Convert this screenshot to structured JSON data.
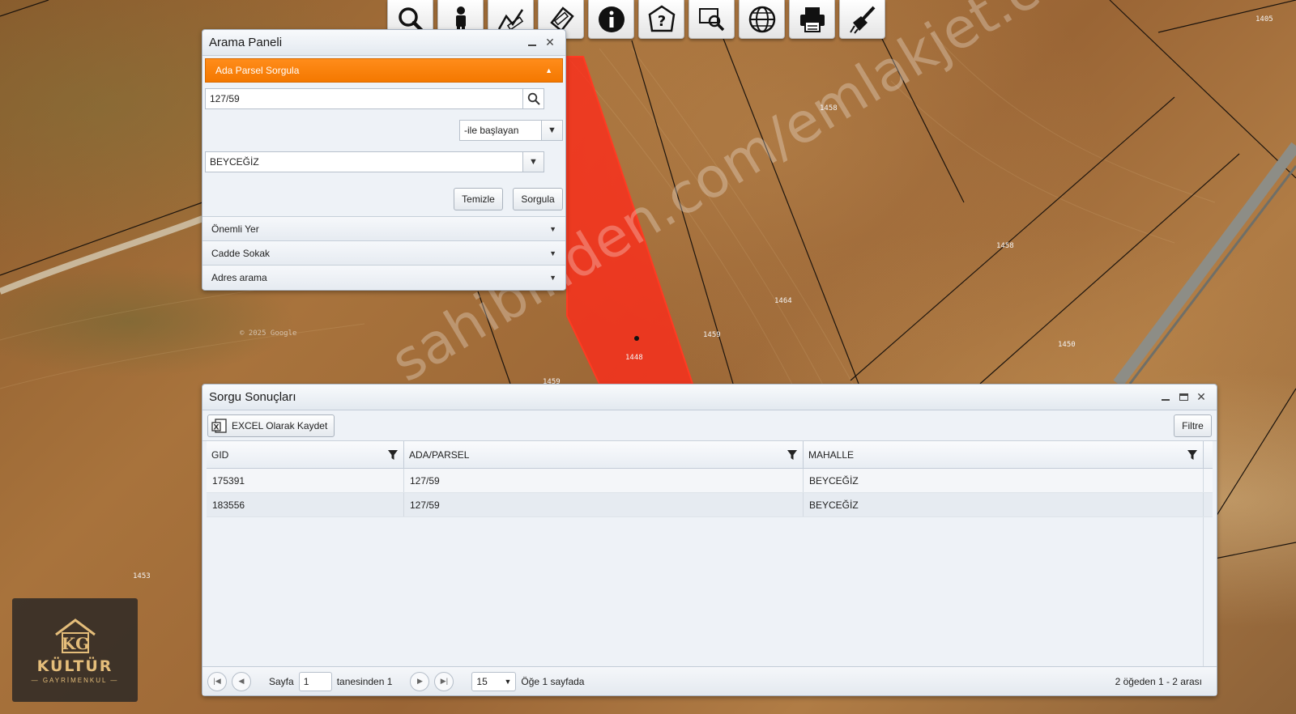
{
  "map": {
    "parcel_labels": [
      "1458",
      "1458",
      "1464",
      "1459",
      "1448",
      "1450",
      "1405",
      "1453",
      "1459"
    ],
    "copyright": "© 2025 Google"
  },
  "toolbar": {
    "icons": [
      "search-icon",
      "person-icon",
      "measure-icon",
      "ruler-icon",
      "info-icon",
      "help-icon",
      "zoom-area-icon",
      "globe-icon",
      "print-icon",
      "clear-icon"
    ]
  },
  "search_panel": {
    "title": "Arama Paneli",
    "active_section": "Ada Parsel Sorgula",
    "query_value": "127/59",
    "match_mode": "-ile başlayan",
    "neighborhood": "BEYCEĞİZ",
    "clear_label": "Temizle",
    "submit_label": "Sorgula",
    "sections": [
      "Önemli Yer",
      "Cadde Sokak",
      "Adres arama"
    ]
  },
  "results_panel": {
    "title": "Sorgu Sonuçları",
    "export_label": "EXCEL Olarak Kaydet",
    "filter_label": "Filtre",
    "columns": [
      "GID",
      "ADA/PARSEL",
      "MAHALLE"
    ],
    "rows": [
      [
        "175391",
        "127/59",
        "BEYCEĞİZ"
      ],
      [
        "183556",
        "127/59",
        "BEYCEĞİZ"
      ]
    ],
    "pager": {
      "page_label": "Sayfa",
      "page_value": "1",
      "of_label": "tanesinden 1",
      "page_size": "15",
      "per_page_label": "Öğe 1 sayfada",
      "summary": "2 öğeden 1 - 2 arası"
    }
  },
  "logo": {
    "brand": "KÜLTÜR",
    "sub": "— GAYRİMENKUL —"
  },
  "watermark": "sahibinden.com/emlakjet.com",
  "colors": {
    "accent": "#f47800",
    "highlight": "#ff2a1a"
  }
}
